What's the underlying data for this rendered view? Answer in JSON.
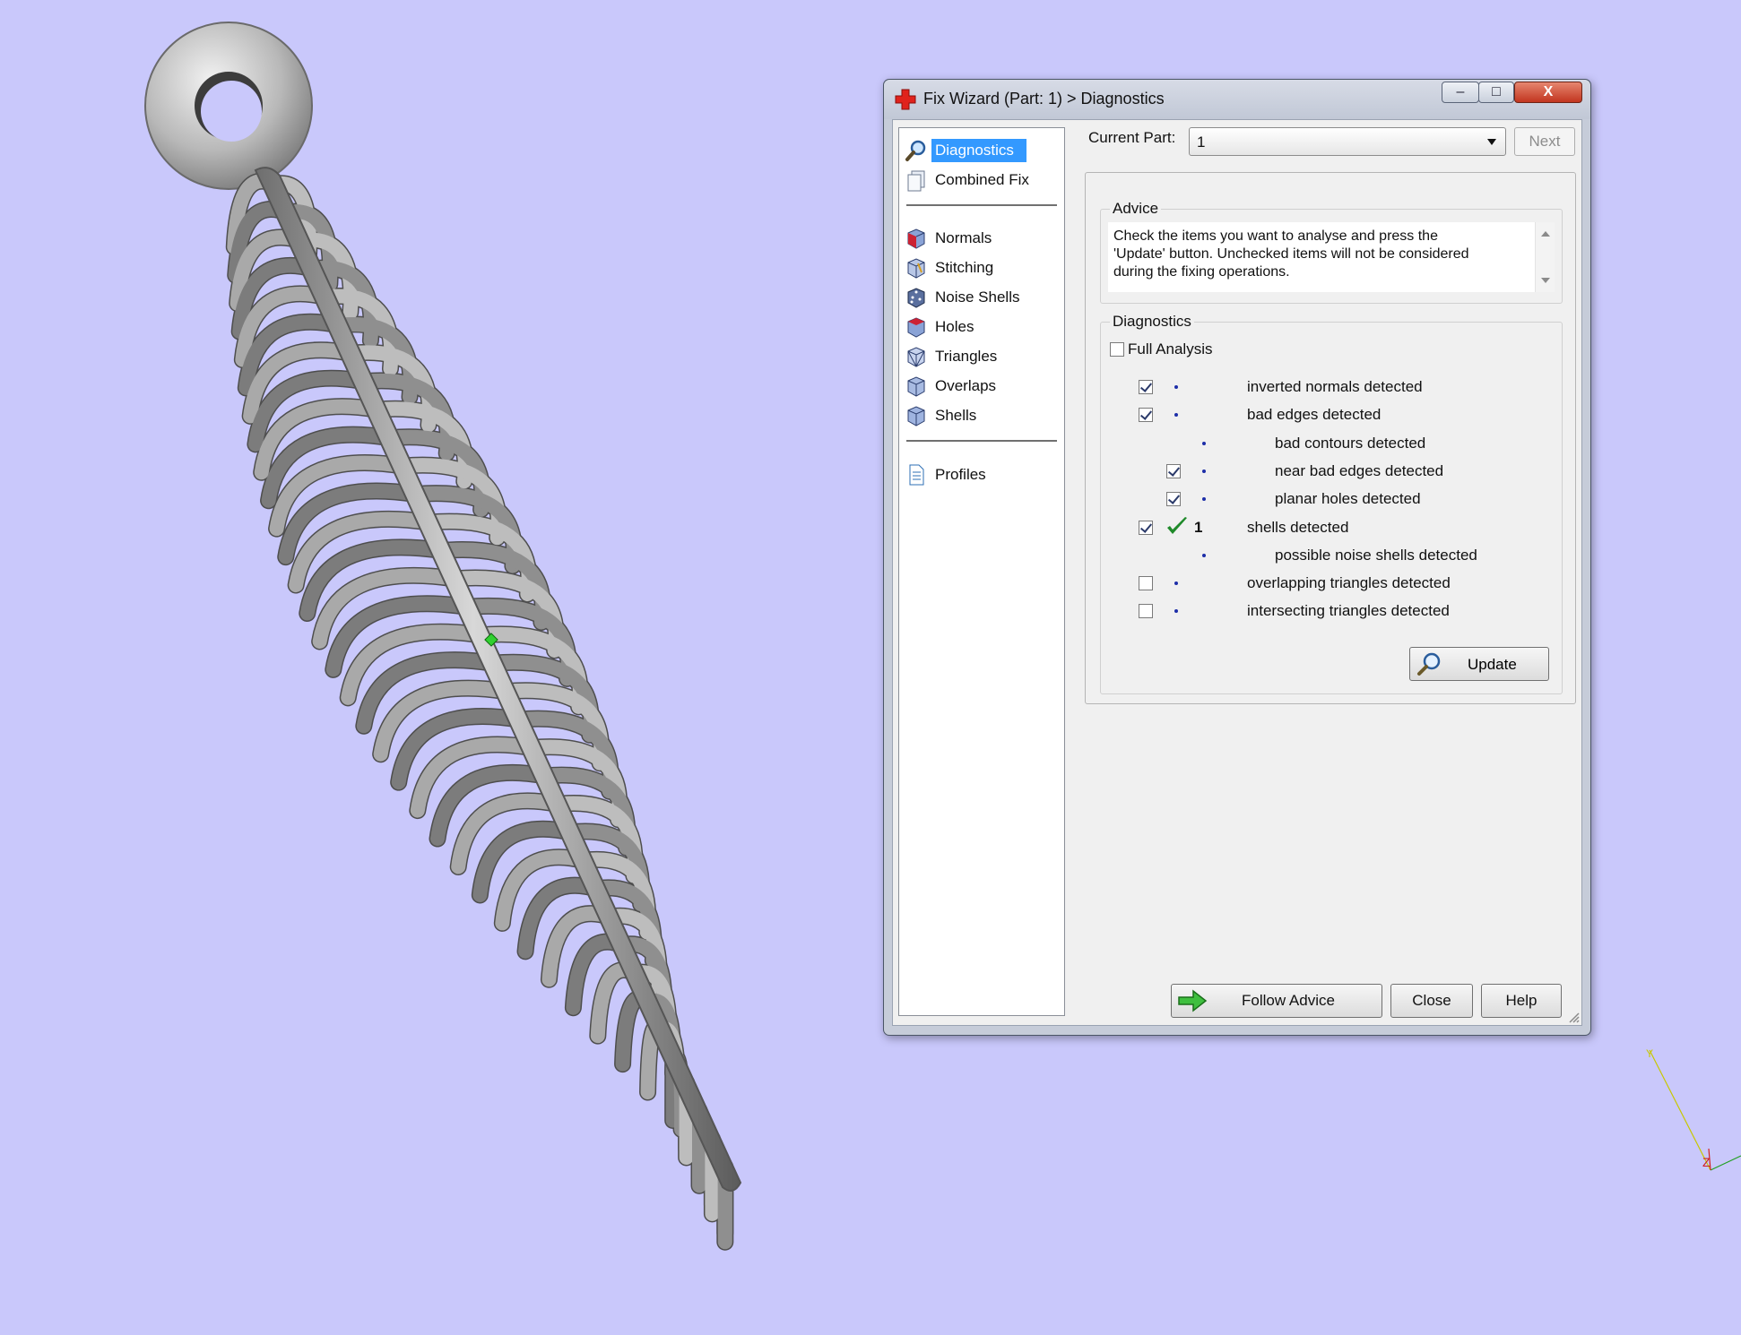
{
  "window": {
    "title": "Fix Wizard (Part: 1) > Diagnostics",
    "minimize_glyph": "–",
    "maximize_glyph": "□",
    "close_glyph": "X"
  },
  "nav": {
    "items": [
      {
        "label": "Diagnostics",
        "icon": "magnifier-icon",
        "selected": true
      },
      {
        "label": "Combined Fix",
        "icon": "pages-icon"
      },
      {
        "label": "Normals",
        "icon": "cube-red-icon"
      },
      {
        "label": "Stitching",
        "icon": "cube-stitch-icon"
      },
      {
        "label": "Noise Shells",
        "icon": "dice-icon"
      },
      {
        "label": "Holes",
        "icon": "cube-red-icon"
      },
      {
        "label": "Triangles",
        "icon": "cube-wire-icon"
      },
      {
        "label": "Overlaps",
        "icon": "cube-overlap-icon"
      },
      {
        "label": "Shells",
        "icon": "cube-blue-icon"
      },
      {
        "label": "Profiles",
        "icon": "document-icon"
      }
    ]
  },
  "current_part": {
    "label": "Current Part:",
    "value": "1",
    "next_label": "Next"
  },
  "advice": {
    "title": "Advice",
    "text_line1": "Check the items you want to analyse and press the",
    "text_line2": "'Update' button. Unchecked items will not be considered",
    "text_line3": "during the fixing operations."
  },
  "diagnostics": {
    "title": "Diagnostics",
    "full_analysis_label": "Full Analysis",
    "full_analysis_checked": false,
    "rows": [
      {
        "label": "inverted normals detected",
        "checked": true,
        "status": "dot",
        "indent": 0
      },
      {
        "label": "bad edges detected",
        "checked": true,
        "status": "dot",
        "indent": 0
      },
      {
        "label": "bad contours detected",
        "checked": null,
        "status": "dot",
        "indent": 1
      },
      {
        "label": "near bad edges detected",
        "checked": true,
        "status": "dot",
        "indent": 1
      },
      {
        "label": "planar holes detected",
        "checked": true,
        "status": "dot",
        "indent": 1
      },
      {
        "label": "shells detected",
        "checked": true,
        "status": "ok",
        "count": "1",
        "indent": 0
      },
      {
        "label": "possible noise shells detected",
        "checked": null,
        "status": "dot",
        "indent": 1
      },
      {
        "label": "overlapping triangles detected",
        "checked": false,
        "status": "dot",
        "indent": 0
      },
      {
        "label": "intersecting triangles detected",
        "checked": false,
        "status": "dot",
        "indent": 0
      }
    ],
    "update_label": "Update"
  },
  "footer": {
    "follow_advice_label": "Follow Advice",
    "close_label": "Close",
    "help_label": "Help"
  },
  "colors": {
    "background": "#c9c8fb",
    "selection": "#3399ff",
    "ok_check": "#1f8a2a",
    "model_gray": "#8e8e8e"
  }
}
